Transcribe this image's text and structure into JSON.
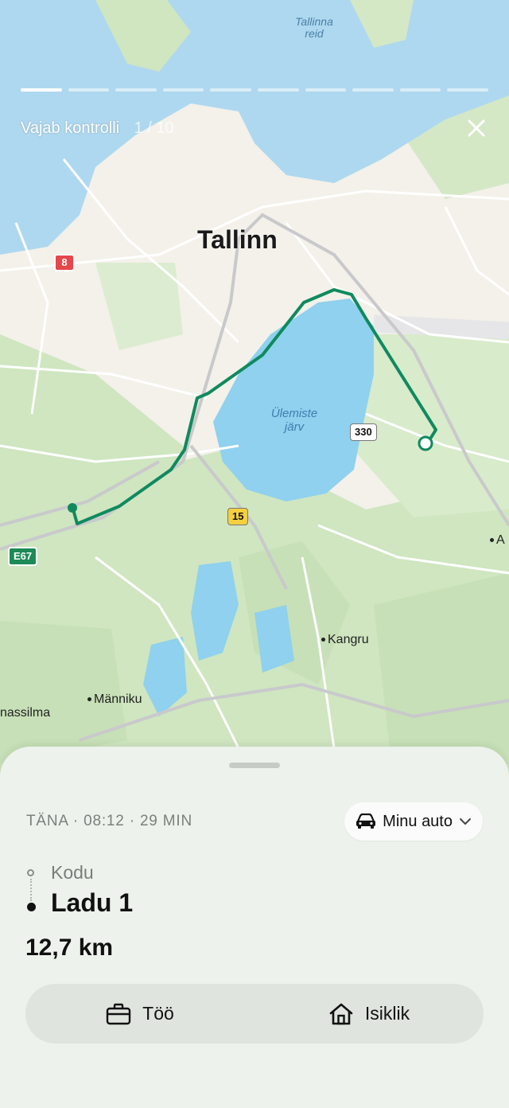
{
  "header": {
    "title": "Vajab kontrolli",
    "counter": "1 / 10",
    "progress_total": 10,
    "progress_current": 1
  },
  "map": {
    "city_label": "Tallinn",
    "bay_label": "Tallinna\nreid",
    "lake_label": "Ülemiste\njärv",
    "places": [
      "Kangru",
      "Männiku",
      "nassilma",
      "A"
    ],
    "road_shields": [
      {
        "text": "8",
        "kind": "red"
      },
      {
        "text": "330",
        "kind": "white"
      },
      {
        "text": "15",
        "kind": "yellow"
      },
      {
        "text": "E67",
        "kind": "green"
      }
    ],
    "route_color": "#0f8a5f"
  },
  "trip": {
    "meta": "TÄNA · 08:12 · 29 MIN",
    "vehicle": "Minu auto",
    "from": "Kodu",
    "to": "Ladu 1",
    "distance": "12,7 km"
  },
  "actions": {
    "work_label": "Töö",
    "personal_label": "Isiklik"
  },
  "icons": {
    "close": "close-icon",
    "car": "car-icon",
    "chevron": "chevron-down-icon",
    "briefcase": "briefcase-icon",
    "home": "home-icon"
  }
}
